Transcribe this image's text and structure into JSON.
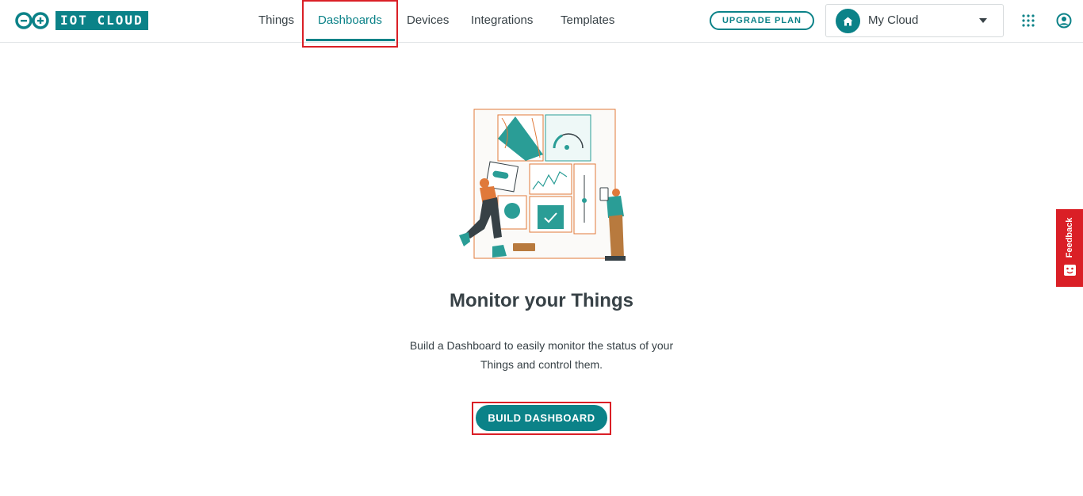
{
  "header": {
    "logo_text": "IOT CLOUD",
    "nav": [
      {
        "label": "Things",
        "active": false
      },
      {
        "label": "Dashboards",
        "active": true
      },
      {
        "label": "Devices",
        "active": false
      },
      {
        "label": "Integrations",
        "active": false
      },
      {
        "label": "Templates",
        "active": false
      }
    ],
    "upgrade_label": "UPGRADE PLAN",
    "cloud_selector": {
      "selected": "My Cloud",
      "icon": "home-icon"
    },
    "apps_icon": "apps-grid-icon",
    "account_icon": "user-account-icon"
  },
  "main": {
    "title": "Monitor your Things",
    "description": "Build a Dashboard to easily monitor the status of your Things and control them.",
    "build_button_label": "BUILD DASHBOARD"
  },
  "feedback": {
    "label": "Feedback",
    "icon": "feedback-face-icon"
  },
  "colors": {
    "accent": "#0b8288",
    "highlight": "#da1f26",
    "text": "#374146",
    "illustration_orange": "#e0793a"
  }
}
